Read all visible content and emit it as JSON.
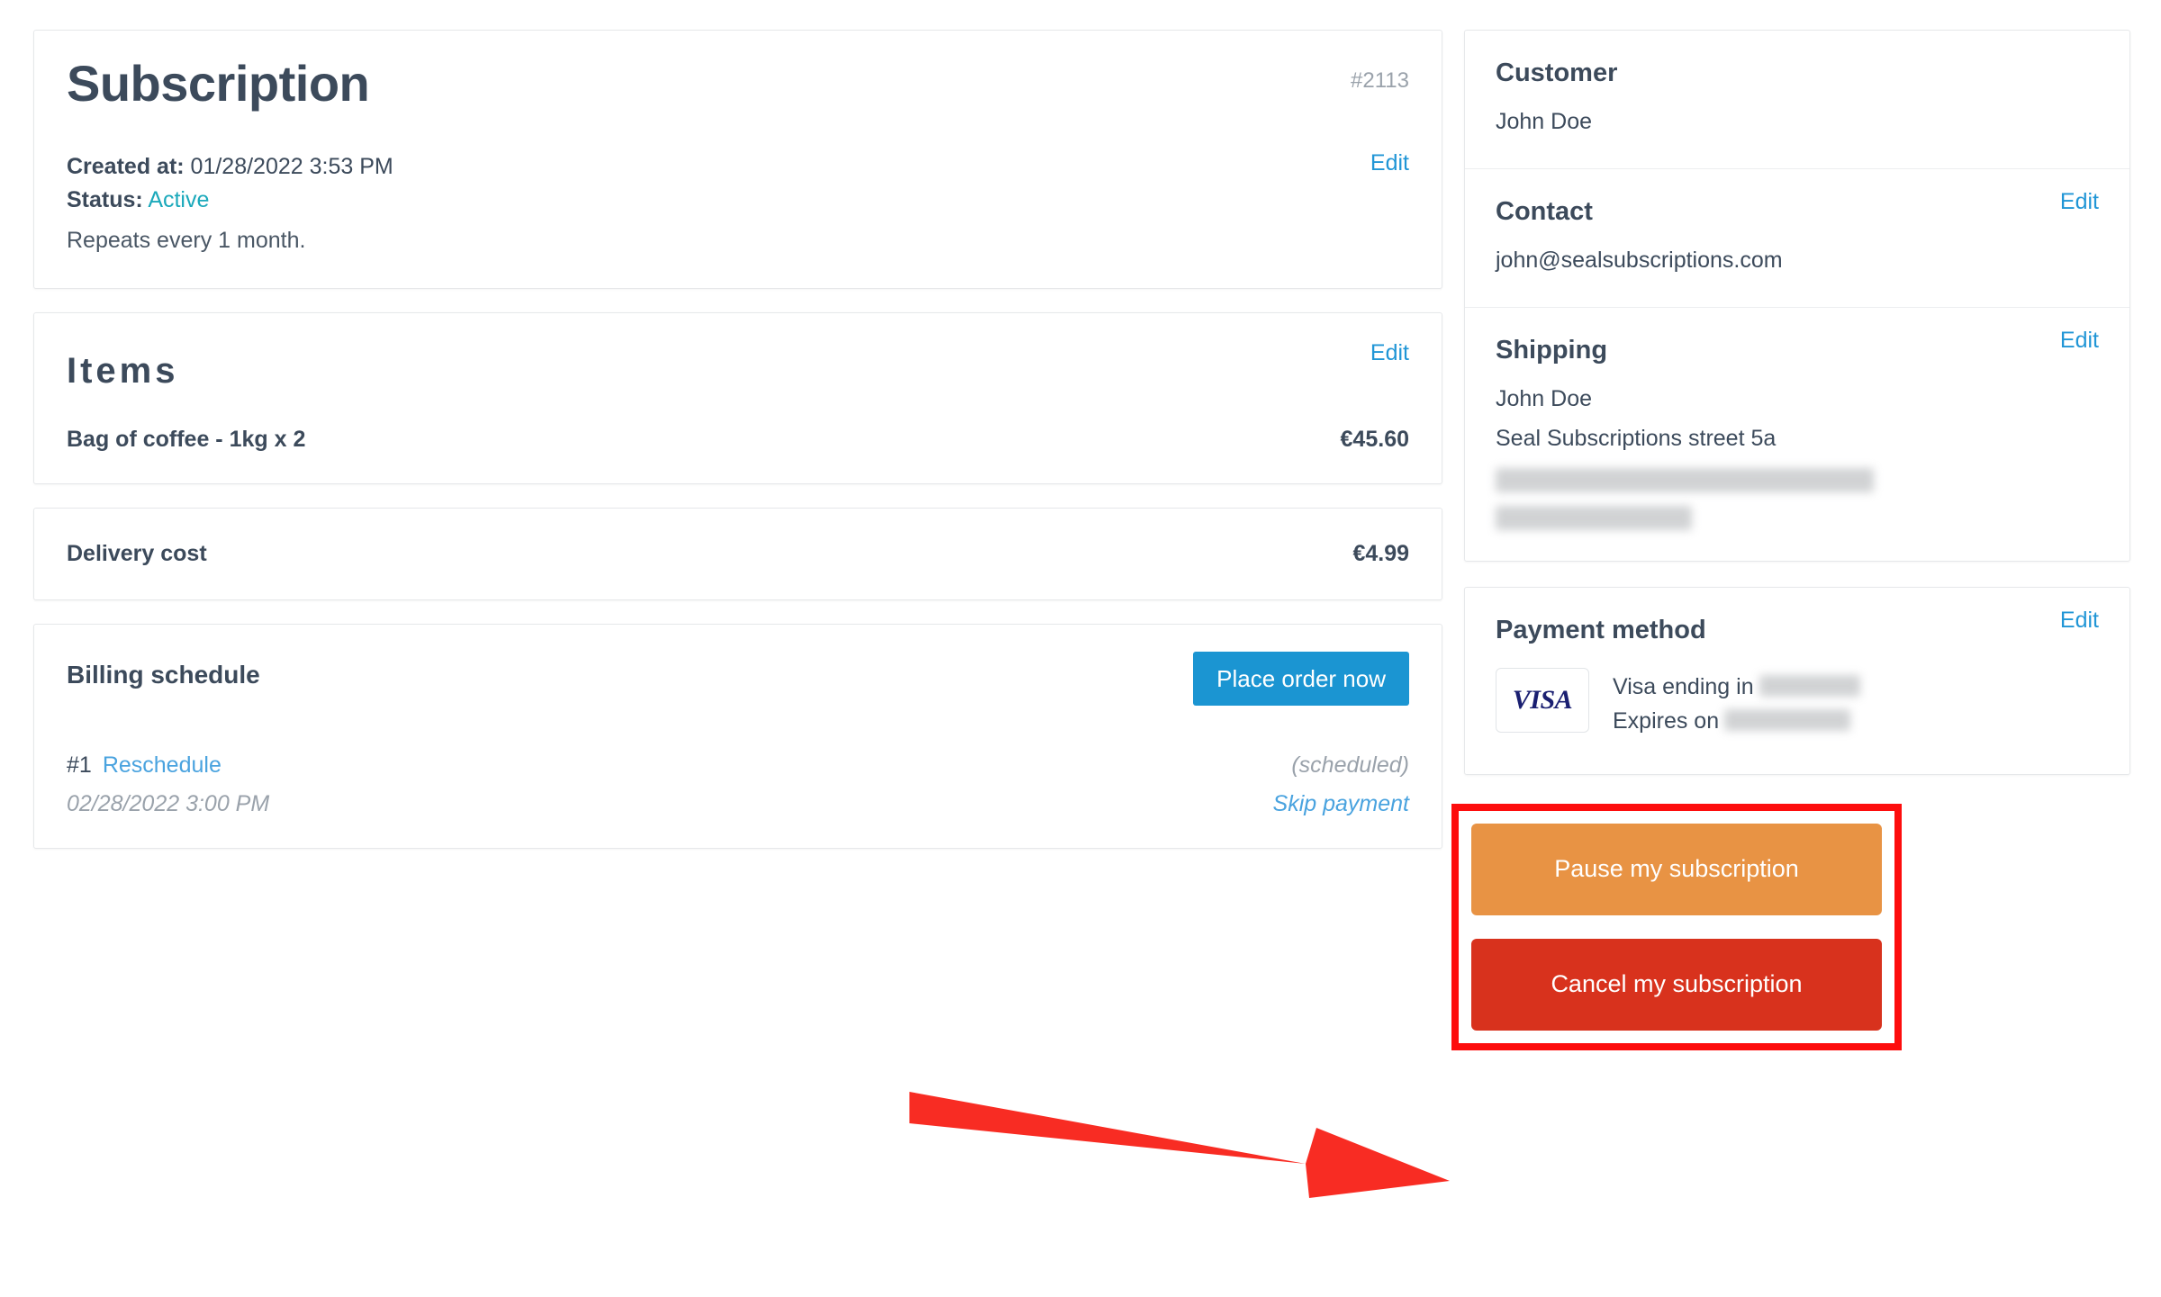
{
  "subscription": {
    "title": "Subscription",
    "id": "#2113",
    "created_label": "Created at:",
    "created_value": "01/28/2022 3:53 PM",
    "status_label": "Status:",
    "status_value": "Active",
    "repeats": "Repeats every 1 month.",
    "edit_label": "Edit"
  },
  "items": {
    "title": "Items",
    "edit_label": "Edit",
    "rows": [
      {
        "name": "Bag of coffee - 1kg x 2",
        "price": "€45.60"
      }
    ]
  },
  "delivery": {
    "label": "Delivery cost",
    "price": "€4.99"
  },
  "billing": {
    "title": "Billing schedule",
    "place_order_label": "Place order now",
    "entry_number": "#1",
    "reschedule_label": "Reschedule",
    "state": "(scheduled)",
    "date": "02/28/2022 3:00 PM",
    "skip_label": "Skip payment"
  },
  "customer": {
    "title": "Customer",
    "name": "John Doe"
  },
  "contact": {
    "title": "Contact",
    "edit_label": "Edit",
    "email": "john@sealsubscriptions.com"
  },
  "shipping": {
    "title": "Shipping",
    "edit_label": "Edit",
    "name": "John Doe",
    "street": "Seal Subscriptions street 5a",
    "city_redacted": "",
    "country_redacted": ""
  },
  "payment": {
    "title": "Payment method",
    "edit_label": "Edit",
    "card_brand": "VISA",
    "ending_label": "Visa ending in",
    "ending_redacted": "",
    "expires_label": "Expires on",
    "expires_redacted": ""
  },
  "actions": {
    "pause_label": "Pause my subscription",
    "cancel_label": "Cancel my subscription"
  },
  "annotation": {
    "highlight_color": "#fd0d0d",
    "arrow_color": "#f82c23"
  },
  "colors": {
    "link": "#2196d6",
    "status_active": "#1ba9bb",
    "primary_button": "#1b95d2",
    "pause_button": "#e89344",
    "cancel_button": "#d8321d",
    "heading": "#3c4a5b"
  }
}
